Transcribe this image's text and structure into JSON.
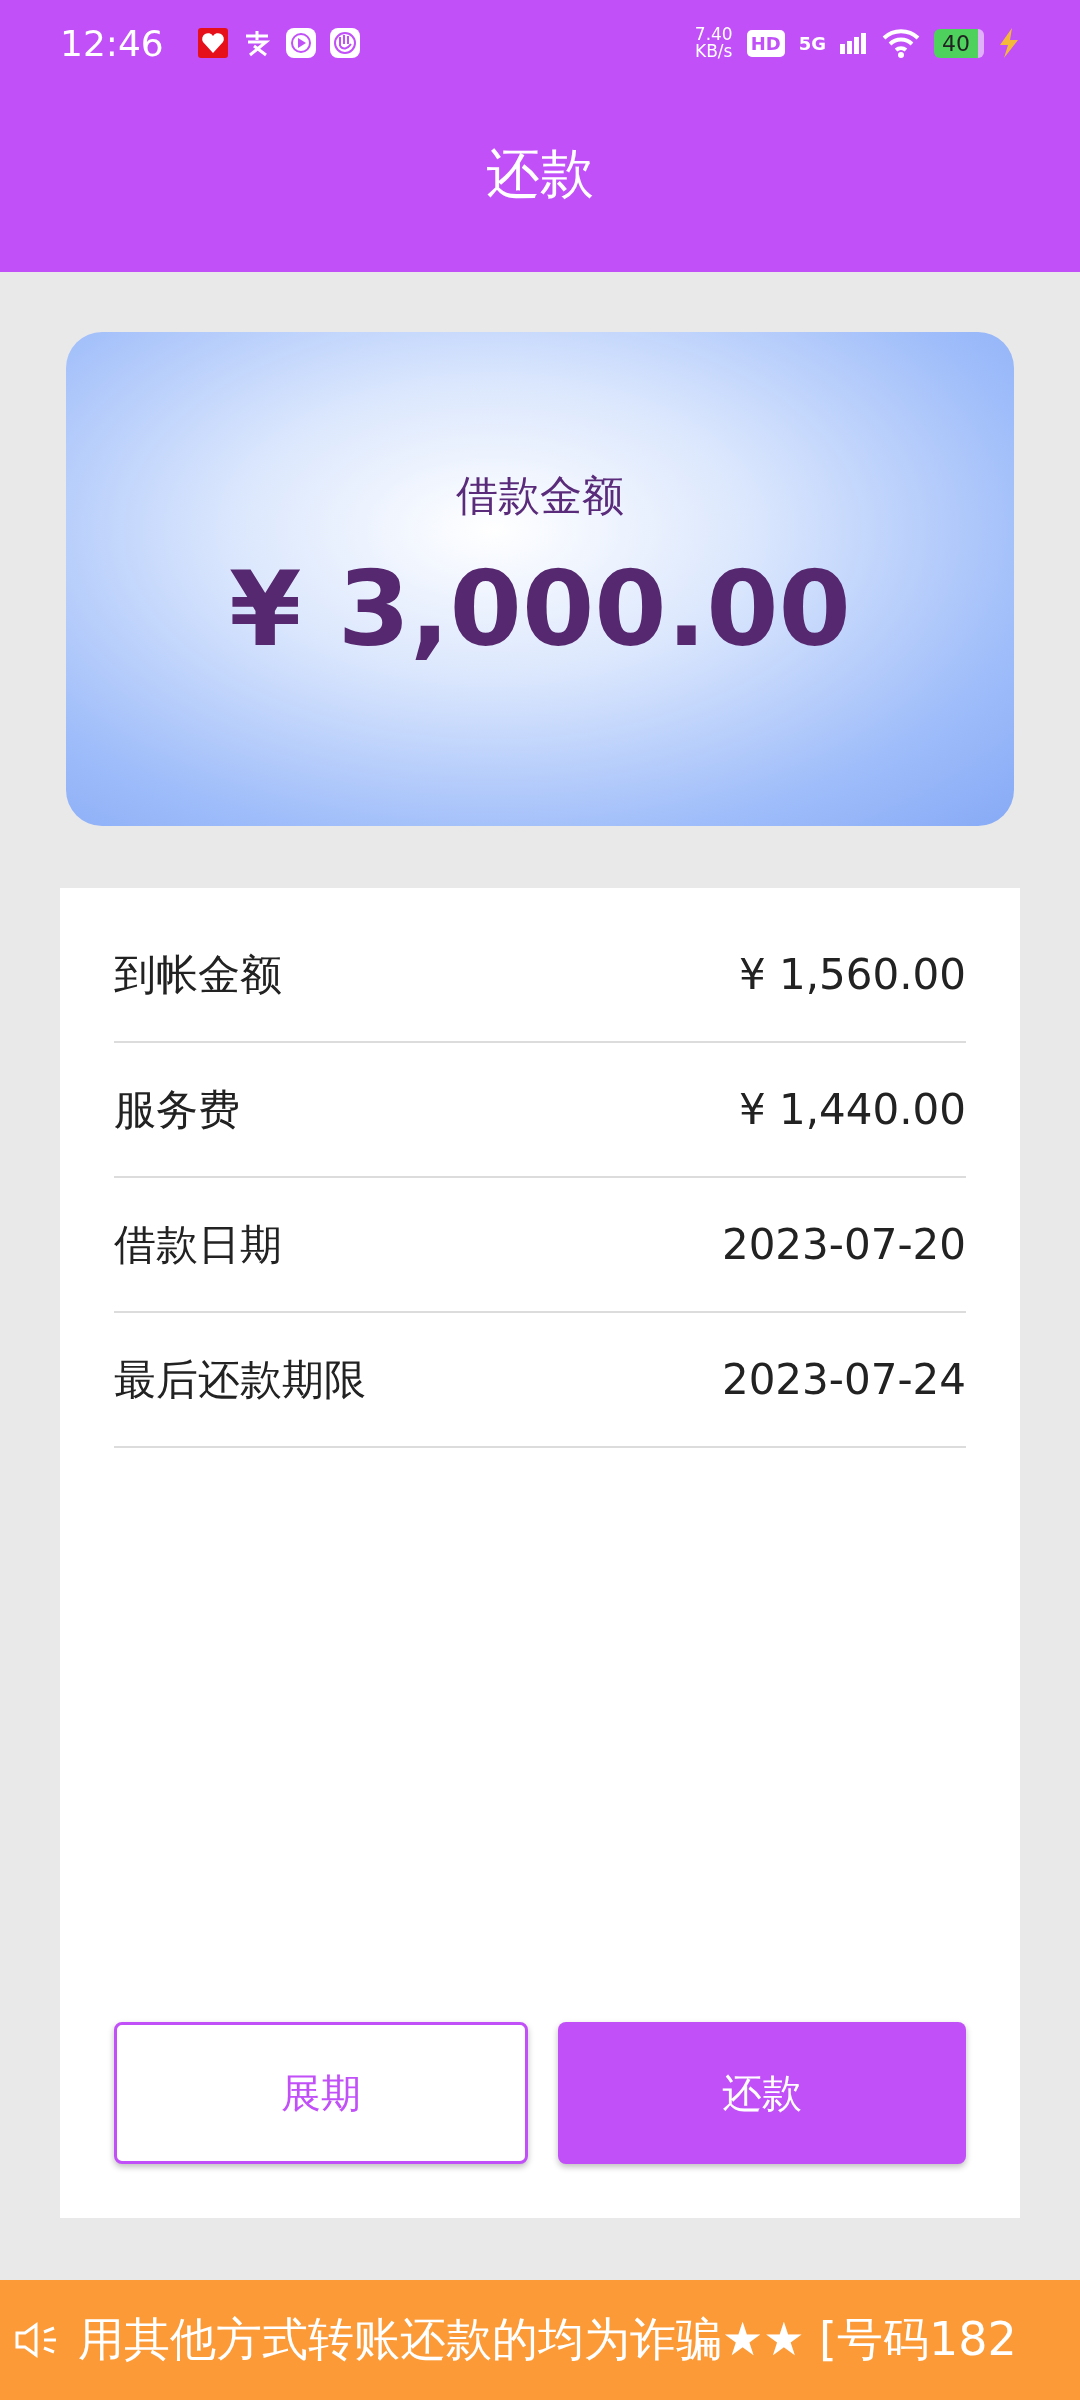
{
  "status_bar": {
    "time": "12:46",
    "net_speed": "7.40",
    "net_unit": "KB/s",
    "hd": "HD",
    "network": "5G",
    "battery": "40"
  },
  "header": {
    "title": "还款"
  },
  "loan_card": {
    "label": "借款金额",
    "amount": "¥ 3,000.00"
  },
  "details": [
    {
      "label": "到帐金额",
      "value": "¥ 1,560.00"
    },
    {
      "label": "服务费",
      "value": "¥ 1,440.00"
    },
    {
      "label": "借款日期",
      "value": "2023-07-20"
    },
    {
      "label": "最后还款期限",
      "value": "2023-07-24"
    }
  ],
  "buttons": [
    {
      "label": "展期",
      "kind": "outline"
    },
    {
      "label": "还款",
      "kind": "filled"
    }
  ],
  "notice": {
    "text": "用其他方式转账还款的均为诈骗★★ [号码182"
  }
}
